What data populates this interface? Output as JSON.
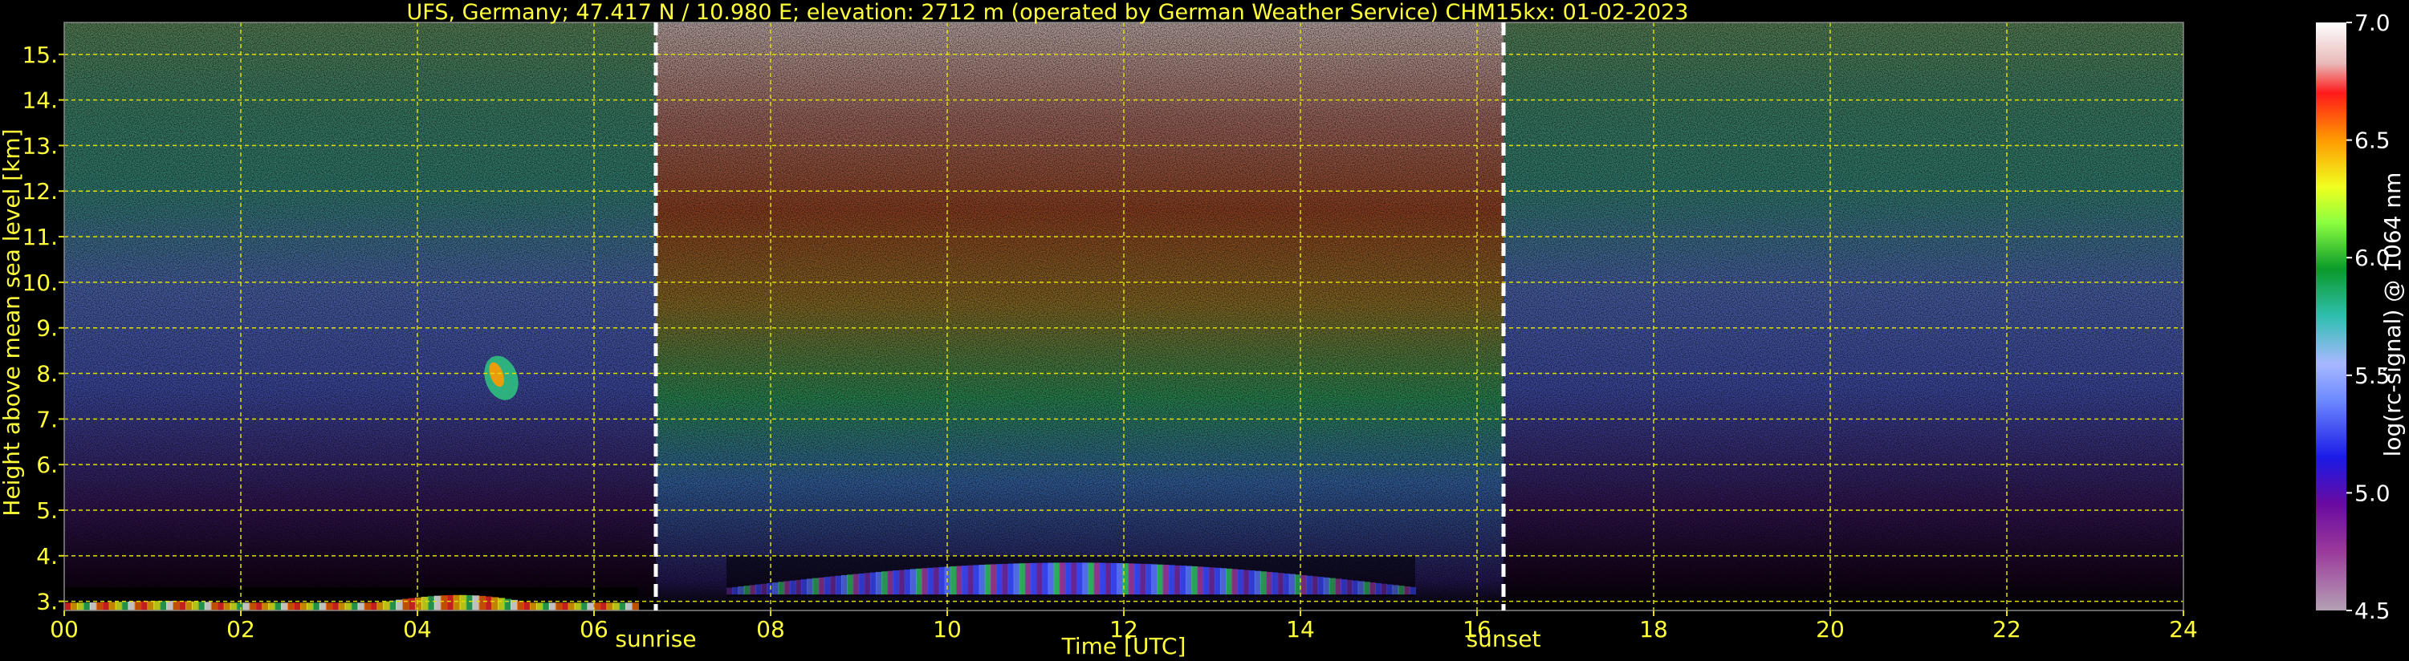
{
  "chart_data": {
    "type": "heatmap",
    "title": "UFS, Germany; 47.417 N / 10.980 E; elevation: 2712 m  (operated by German Weather Service)    CHM15kx: 01-02-2023",
    "xlabel": "Time [UTC]",
    "ylabel": "Height above mean sea level [km]",
    "xlim": [
      0,
      24
    ],
    "ylim": [
      2.8,
      15.7
    ],
    "x_ticks": [
      "00",
      "02",
      "04",
      "06",
      "08",
      "10",
      "12",
      "14",
      "16",
      "18",
      "20",
      "22",
      "24"
    ],
    "y_ticks": [
      "3.",
      "4.",
      "5.",
      "6.",
      "7.",
      "8.",
      "9.",
      "10.",
      "11.",
      "12.",
      "13.",
      "14.",
      "15."
    ],
    "grid": true,
    "annotations": [
      {
        "label": "sunrise",
        "x": 6.7
      },
      {
        "label": "sunset",
        "x": 16.3
      }
    ],
    "colorbar": {
      "label": "log(rc-signal) @ 1064 nm",
      "range": [
        4.5,
        7.0
      ],
      "ticks": [
        "4.5",
        "5.0",
        "5.5",
        "6.0",
        "6.5",
        "7.0"
      ]
    },
    "features": [
      {
        "name": "cloud",
        "x": [
          4.7,
          5.2
        ],
        "y": [
          7.4,
          8.4
        ]
      },
      {
        "name": "boundary layer",
        "x": [
          7.5,
          15.3
        ],
        "y": [
          3.1,
          4.0
        ]
      },
      {
        "name": "surface layer",
        "x": [
          0,
          6.5
        ],
        "y": [
          2.8,
          3.3
        ]
      }
    ]
  },
  "colors": {
    "text": "#ffff3a",
    "grid": "#e0e000",
    "background": "#000000"
  }
}
